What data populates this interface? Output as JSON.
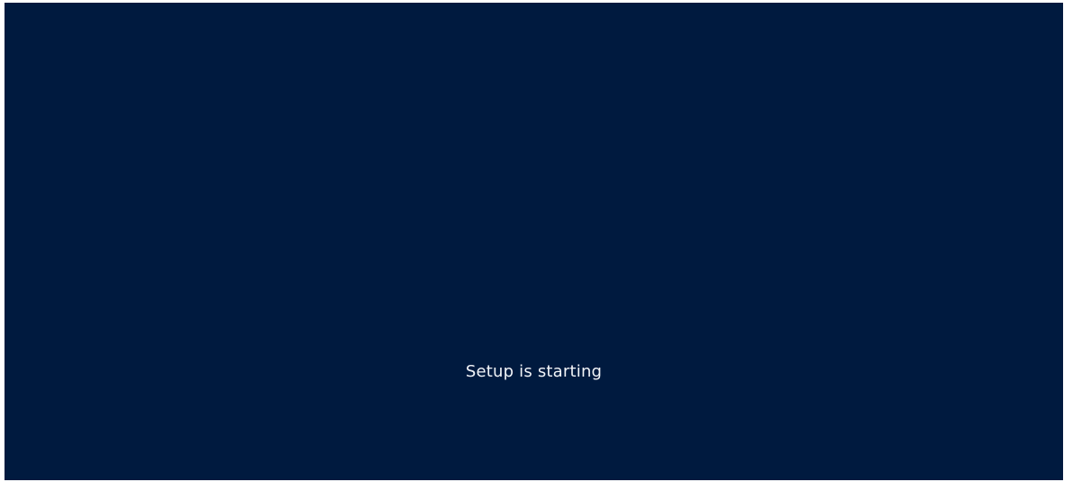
{
  "screen": {
    "background_color": "#001a3f",
    "text_color": "#f2f4f8",
    "status_text": "Setup is starting"
  }
}
